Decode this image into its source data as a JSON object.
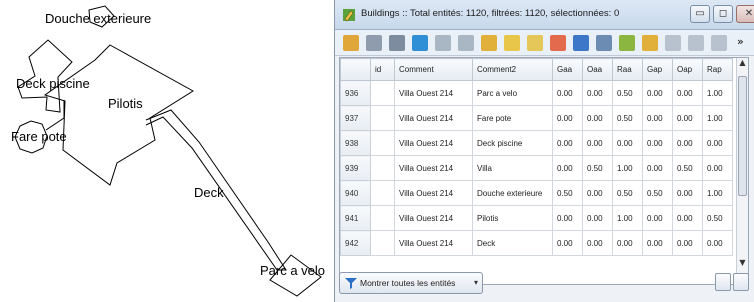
{
  "map": {
    "labels": [
      {
        "id": "douche",
        "text": "Douche exterieure"
      },
      {
        "id": "deck-piscine",
        "text": "Deck piscine"
      },
      {
        "id": "pilotis",
        "text": "Pilotis"
      },
      {
        "id": "fare-pote",
        "text": "Fare pote"
      },
      {
        "id": "deck",
        "text": "Deck"
      },
      {
        "id": "parc",
        "text": "Parc a velo"
      }
    ]
  },
  "window": {
    "title": "Buildings :: Total entités: 1120, filtrées: 1120, sélectionnées: 0",
    "min_glyph": "▭",
    "max_glyph": "◻",
    "close_glyph": "✕",
    "icon": "qgis-pencil-icon"
  },
  "toolbar": {
    "icons": [
      {
        "name": "toggle-editing-icon",
        "color": "#e0a63a"
      },
      {
        "name": "multi-edit-icon",
        "color": "#8f9cae"
      },
      {
        "name": "save-edits-icon",
        "color": "#7d8c9e"
      },
      {
        "name": "reload-icon",
        "color": "#2f8fd6"
      },
      {
        "name": "add-feature-icon",
        "color": "#a9b6c4"
      },
      {
        "name": "delete-feature-icon",
        "color": "#a9b6c4"
      },
      {
        "name": "expression-select-icon",
        "color": "#e0b03a"
      },
      {
        "name": "select-all-icon",
        "color": "#e8c64a"
      },
      {
        "name": "invert-selection-icon",
        "color": "#e5c659"
      },
      {
        "name": "deselect-icon",
        "color": "#e46a4e"
      },
      {
        "name": "filter-selection-icon",
        "color": "#3f77c8"
      },
      {
        "name": "move-selection-top-icon",
        "color": "#6c8cb4"
      },
      {
        "name": "pan-to-selection-icon",
        "color": "#8bb63f"
      },
      {
        "name": "zoom-to-selection-icon",
        "color": "#e0b03a"
      },
      {
        "name": "copy-rows-icon",
        "color": "#b8c2cf"
      },
      {
        "name": "paste-icon",
        "color": "#b8c2cf"
      },
      {
        "name": "new-field-icon",
        "color": "#b8c2cf"
      }
    ],
    "more_glyph": "»"
  },
  "table": {
    "columns": [
      "",
      "id",
      "Comment",
      "Comment2",
      "Gaa",
      "Oaa",
      "Raa",
      "Gap",
      "Oap",
      "Rap"
    ],
    "rows": [
      {
        "rownum": "936",
        "id": "",
        "comment": "Villa Ouest 214",
        "comment2": "Parc a velo",
        "gaa": "0.00",
        "oaa": "0.00",
        "raa": "0.50",
        "gap": "0.00",
        "oap": "0.00",
        "rap": "1.00"
      },
      {
        "rownum": "937",
        "id": "",
        "comment": "Villa Ouest 214",
        "comment2": "Fare pote",
        "gaa": "0.00",
        "oaa": "0.00",
        "raa": "0.50",
        "gap": "0.00",
        "oap": "0.00",
        "rap": "1.00"
      },
      {
        "rownum": "938",
        "id": "",
        "comment": "Villa Ouest 214",
        "comment2": "Deck piscine",
        "gaa": "0.00",
        "oaa": "0.00",
        "raa": "0.00",
        "gap": "0.00",
        "oap": "0.00",
        "rap": "0.00"
      },
      {
        "rownum": "939",
        "id": "",
        "comment": "Villa Ouest 214",
        "comment2": "Villa",
        "gaa": "0.00",
        "oaa": "0.50",
        "raa": "1.00",
        "gap": "0.00",
        "oap": "0.50",
        "rap": "0.00"
      },
      {
        "rownum": "940",
        "id": "",
        "comment": "Villa Ouest 214",
        "comment2": "Douche exterieure",
        "gaa": "0.50",
        "oaa": "0.00",
        "raa": "0.50",
        "gap": "0.50",
        "oap": "0.00",
        "rap": "1.00"
      },
      {
        "rownum": "941",
        "id": "",
        "comment": "Villa Ouest 214",
        "comment2": "Pilotis",
        "gaa": "0.00",
        "oaa": "0.00",
        "raa": "1.00",
        "gap": "0.00",
        "oap": "0.00",
        "rap": "0.50"
      },
      {
        "rownum": "942",
        "id": "",
        "comment": "Villa Ouest 214",
        "comment2": "Deck",
        "gaa": "0.00",
        "oaa": "0.00",
        "raa": "0.00",
        "gap": "0.00",
        "oap": "0.00",
        "rap": "0.00"
      }
    ],
    "scroll_up_glyph": "▲",
    "scroll_down_glyph": "▼"
  },
  "footer": {
    "show_all_label": "Montrer toutes les entités",
    "dropdown_glyph": "▾",
    "filter_icon": "funnel-icon",
    "right_icons": [
      "table-view-icon",
      "form-view-icon"
    ]
  }
}
